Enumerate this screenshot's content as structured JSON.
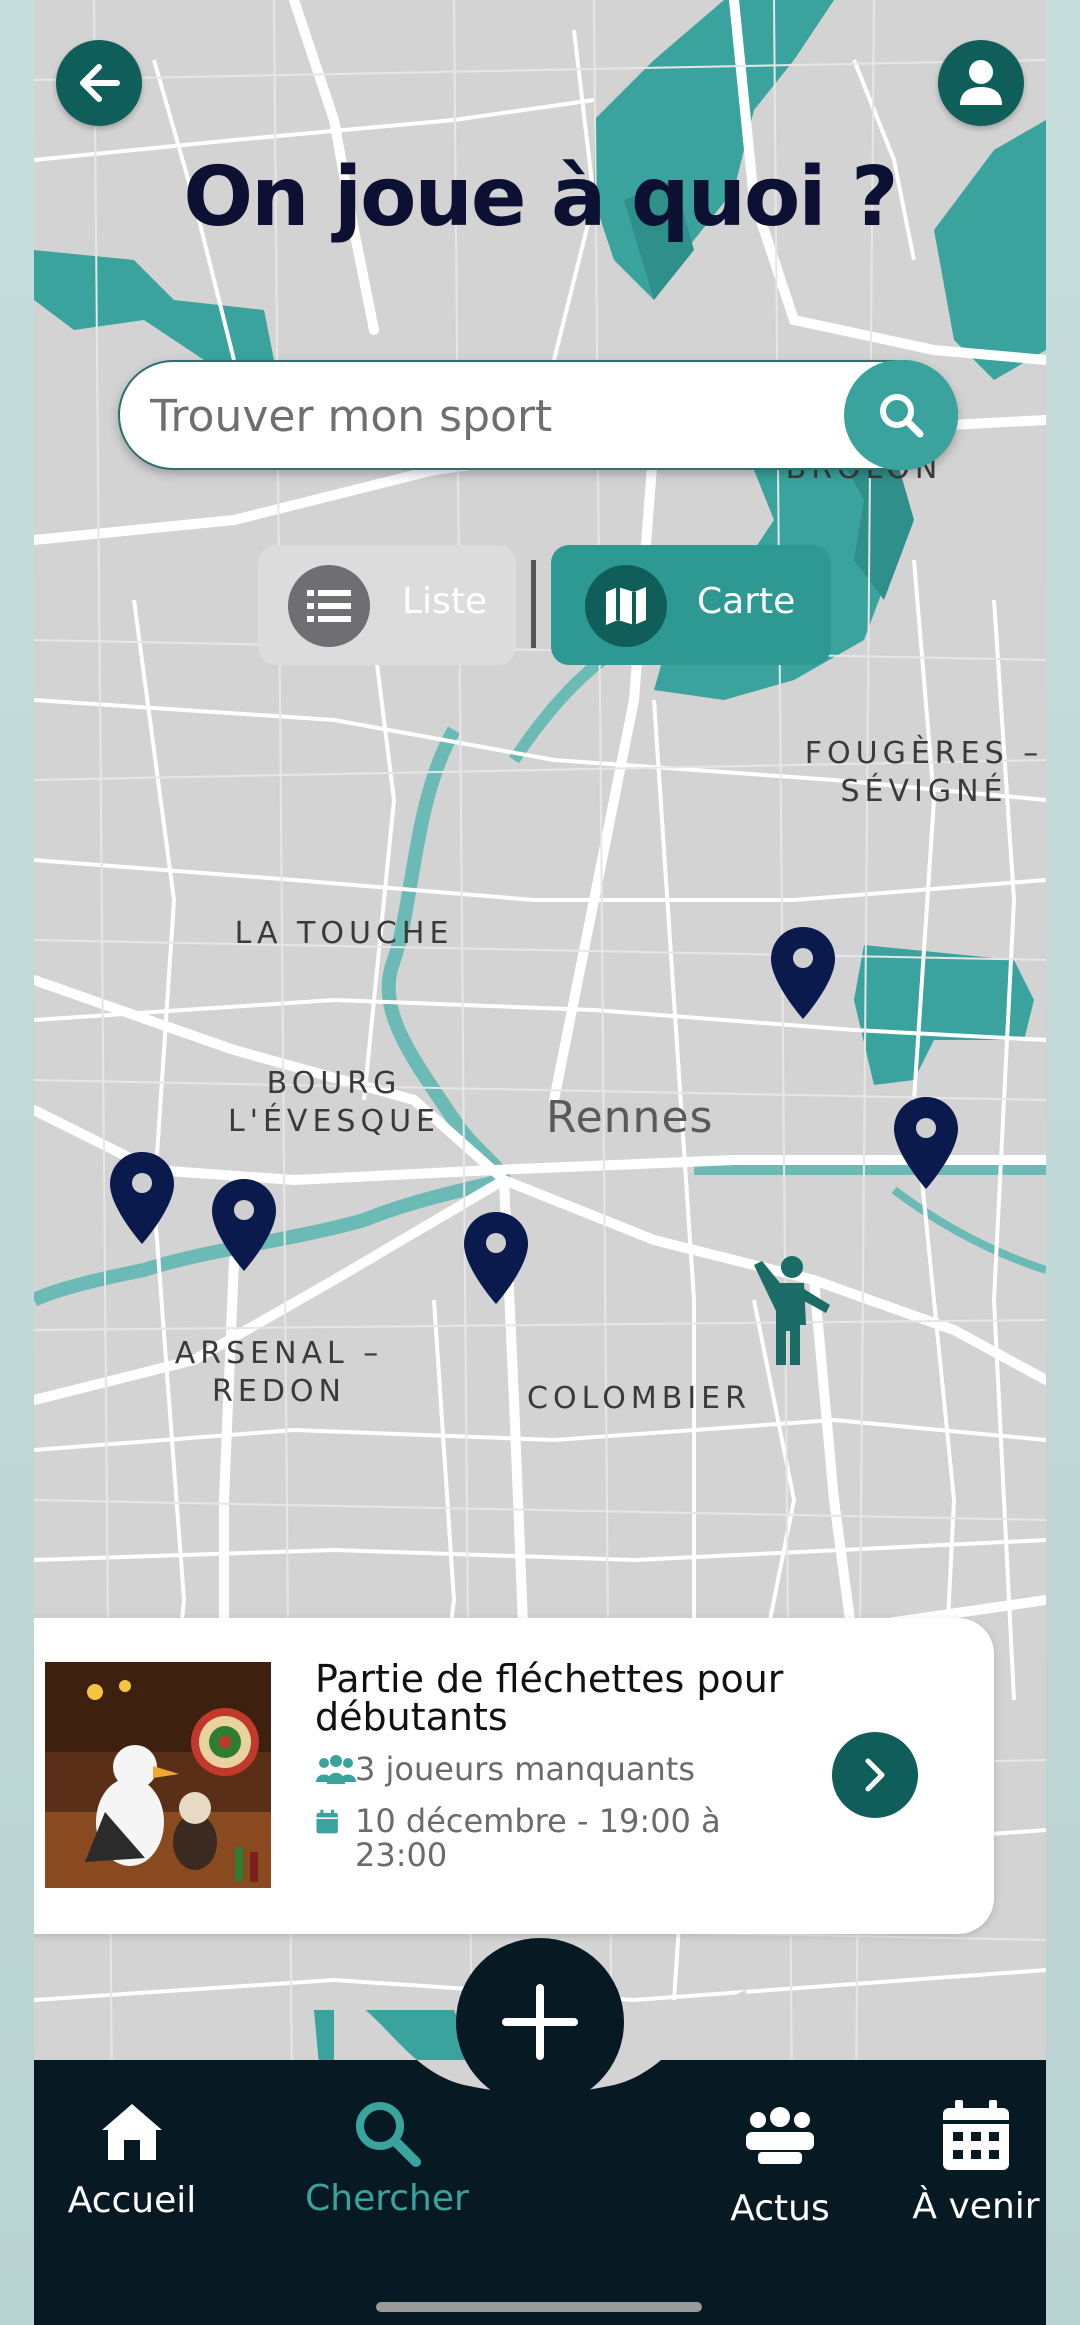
{
  "header": {
    "title": "On joue à quoi ?",
    "back_icon": "arrow-left-icon",
    "profile_icon": "user-icon"
  },
  "search": {
    "placeholder": "Trouver mon sport",
    "icon": "search-icon"
  },
  "view_toggle": {
    "list_label": "Liste",
    "map_label": "Carte",
    "selected": "Carte"
  },
  "map": {
    "city_label": "Rennes",
    "districts": [
      "LA TOUCHE",
      "BOURG L'ÉVESQUE",
      "ARSENAL – REDON",
      "COLOMBIER",
      "FOUGÈRES – SÉVIGNÉ",
      "BROLON"
    ]
  },
  "event_card": {
    "title": "Partie de fléchettes pour débutants",
    "players_missing": "3 joueurs manquants",
    "date_time": "10 décembre - 19:00 à 23:00",
    "players_icon": "users-icon",
    "calendar_icon": "calendar-icon",
    "go_icon": "chevron-right-icon"
  },
  "bottom_nav": {
    "items": [
      {
        "label": "Accueil",
        "icon": "home-icon",
        "active": false
      },
      {
        "label": "Chercher",
        "icon": "search-icon",
        "active": true
      },
      {
        "label": "Actus",
        "icon": "group-icon",
        "active": false
      },
      {
        "label": "À venir",
        "icon": "calendar-icon",
        "active": false
      }
    ],
    "fab_icon": "plus-icon"
  },
  "colors": {
    "primary": "#0f5e5a",
    "accent": "#3aa39d",
    "pin": "#0b1a4d",
    "nav_bg": "#071a23",
    "title": "#0c1033"
  }
}
